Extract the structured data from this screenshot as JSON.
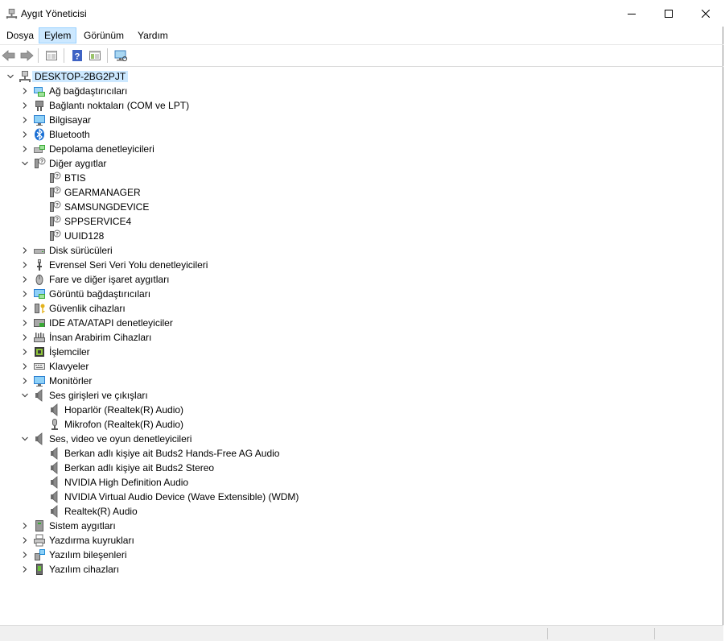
{
  "window": {
    "title": "Aygıt Yöneticisi"
  },
  "menu": [
    "Dosya",
    "Eylem",
    "Görünüm",
    "Yardım"
  ],
  "tree": [
    {
      "label": "DESKTOP-2BG2PJT",
      "icon": "computer-network-icon",
      "level": 0,
      "expander": "expanded",
      "selected": true
    },
    {
      "label": "Ağ bağdaştırıcıları",
      "icon": "network-adapter-icon",
      "level": 1,
      "expander": "collapsed"
    },
    {
      "label": "Bağlantı noktaları (COM ve LPT)",
      "icon": "port-icon",
      "level": 1,
      "expander": "collapsed"
    },
    {
      "label": "Bilgisayar",
      "icon": "computer-icon",
      "level": 1,
      "expander": "collapsed"
    },
    {
      "label": "Bluetooth",
      "icon": "bluetooth-icon",
      "level": 1,
      "expander": "collapsed"
    },
    {
      "label": "Depolama denetleyicileri",
      "icon": "storage-controller-icon",
      "level": 1,
      "expander": "collapsed"
    },
    {
      "label": "Diğer aygıtlar",
      "icon": "unknown-device-icon",
      "level": 1,
      "expander": "expanded"
    },
    {
      "label": "BTIS",
      "icon": "unknown-device-icon",
      "level": 2,
      "expander": "none"
    },
    {
      "label": "GEARMANAGER",
      "icon": "unknown-device-icon",
      "level": 2,
      "expander": "none"
    },
    {
      "label": "SAMSUNGDEVICE",
      "icon": "unknown-device-icon",
      "level": 2,
      "expander": "none"
    },
    {
      "label": "SPPSERVICE4",
      "icon": "unknown-device-icon",
      "level": 2,
      "expander": "none"
    },
    {
      "label": "UUID128",
      "icon": "unknown-device-icon",
      "level": 2,
      "expander": "none"
    },
    {
      "label": "Disk sürücüleri",
      "icon": "disk-drive-icon",
      "level": 1,
      "expander": "collapsed"
    },
    {
      "label": "Evrensel Seri Veri Yolu denetleyicileri",
      "icon": "usb-icon",
      "level": 1,
      "expander": "collapsed"
    },
    {
      "label": "Fare ve diğer işaret aygıtları",
      "icon": "mouse-icon",
      "level": 1,
      "expander": "collapsed"
    },
    {
      "label": "Görüntü bağdaştırıcıları",
      "icon": "display-adapter-icon",
      "level": 1,
      "expander": "collapsed"
    },
    {
      "label": "Güvenlik cihazları",
      "icon": "security-key-icon",
      "level": 1,
      "expander": "collapsed"
    },
    {
      "label": "IDE ATA/ATAPI denetleyiciler",
      "icon": "ide-controller-icon",
      "level": 1,
      "expander": "collapsed"
    },
    {
      "label": "İnsan Arabirim Cihazları",
      "icon": "hid-icon",
      "level": 1,
      "expander": "collapsed"
    },
    {
      "label": "İşlemciler",
      "icon": "processor-icon",
      "level": 1,
      "expander": "collapsed"
    },
    {
      "label": "Klavyeler",
      "icon": "keyboard-icon",
      "level": 1,
      "expander": "collapsed"
    },
    {
      "label": "Monitörler",
      "icon": "monitor-icon",
      "level": 1,
      "expander": "collapsed"
    },
    {
      "label": "Ses girişleri ve çıkışları",
      "icon": "speaker-icon",
      "level": 1,
      "expander": "expanded"
    },
    {
      "label": "Hoparlör (Realtek(R) Audio)",
      "icon": "speaker-icon",
      "level": 2,
      "expander": "none"
    },
    {
      "label": "Mikrofon (Realtek(R) Audio)",
      "icon": "microphone-icon",
      "level": 2,
      "expander": "none"
    },
    {
      "label": "Ses, video ve oyun denetleyicileri",
      "icon": "speaker-icon",
      "level": 1,
      "expander": "expanded"
    },
    {
      "label": "Berkan adlı kişiye ait Buds2 Hands-Free AG Audio",
      "icon": "speaker-icon",
      "level": 2,
      "expander": "none"
    },
    {
      "label": "Berkan adlı kişiye ait Buds2 Stereo",
      "icon": "speaker-icon",
      "level": 2,
      "expander": "none"
    },
    {
      "label": "NVIDIA High Definition Audio",
      "icon": "speaker-icon",
      "level": 2,
      "expander": "none"
    },
    {
      "label": "NVIDIA Virtual Audio Device (Wave Extensible) (WDM)",
      "icon": "speaker-icon",
      "level": 2,
      "expander": "none"
    },
    {
      "label": "Realtek(R) Audio",
      "icon": "speaker-icon",
      "level": 2,
      "expander": "none"
    },
    {
      "label": "Sistem aygıtları",
      "icon": "system-device-icon",
      "level": 1,
      "expander": "collapsed"
    },
    {
      "label": "Yazdırma kuyrukları",
      "icon": "printer-icon",
      "level": 1,
      "expander": "collapsed"
    },
    {
      "label": "Yazılım bileşenleri",
      "icon": "software-component-icon",
      "level": 1,
      "expander": "collapsed"
    },
    {
      "label": "Yazılım cihazları",
      "icon": "software-device-icon",
      "level": 1,
      "expander": "collapsed"
    }
  ],
  "colors": {
    "selection": "#cce8ff",
    "selection_border": "#99d1ff",
    "menu_active": "#cce8ff"
  }
}
